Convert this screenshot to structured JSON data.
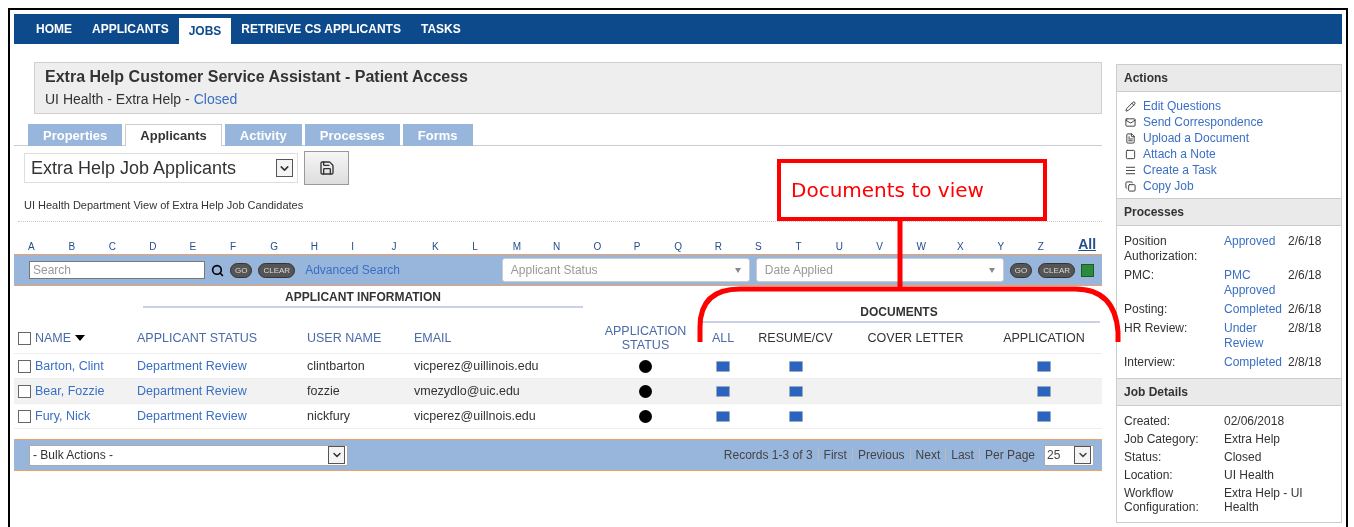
{
  "nav": [
    {
      "label": "HOME",
      "selected": false
    },
    {
      "label": "APPLICANTS",
      "selected": false
    },
    {
      "label": "JOBS",
      "selected": true
    },
    {
      "label": "RETRIEVE CS APPLICANTS",
      "selected": false
    },
    {
      "label": "TASKS",
      "selected": false
    }
  ],
  "job": {
    "title": "Extra Help Customer Service Assistant - Patient Access",
    "subtitle": "UI Health - Extra Help -",
    "status": "Closed"
  },
  "tabs": [
    {
      "label": "Properties",
      "selected": false
    },
    {
      "label": "Applicants",
      "selected": true
    },
    {
      "label": "Activity",
      "selected": false
    },
    {
      "label": "Processes",
      "selected": false
    },
    {
      "label": "Forms",
      "selected": false
    }
  ],
  "view": {
    "value": "Extra Help Job Applicants",
    "description": "UI Health Department View of Extra Help Job Candidates"
  },
  "alphabet": [
    "A",
    "B",
    "C",
    "D",
    "E",
    "F",
    "G",
    "H",
    "I",
    "J",
    "K",
    "L",
    "M",
    "N",
    "O",
    "P",
    "Q",
    "R",
    "S",
    "T",
    "U",
    "V",
    "W",
    "X",
    "Y",
    "Z"
  ],
  "alphabet_all": "All",
  "filters": {
    "search": {
      "placeholder": "Search"
    },
    "go": "GO",
    "clear": "CLEAR",
    "advanced_search": "Advanced Search",
    "applicant_status": {
      "placeholder": "Applicant Status"
    },
    "date_applied": {
      "placeholder": "Date Applied"
    },
    "go_2": "GO",
    "clear_2": "CLEAR"
  },
  "table": {
    "groups": [
      "APPLICANT INFORMATION",
      "DOCUMENTS"
    ],
    "select_all": {
      "checked": false
    },
    "columns": [
      {
        "label": "NAME",
        "sortable": true
      },
      {
        "label": "APPLICANT STATUS",
        "sortable": true
      },
      {
        "label": "USER NAME",
        "sortable": true
      },
      {
        "label": "EMAIL",
        "sortable": true
      },
      {
        "label": "APPLICATION STATUS",
        "sortable": true
      },
      {
        "label": "ALL",
        "sortable": true
      },
      {
        "label": "RESUME/CV",
        "sortable": false
      },
      {
        "label": "COVER LETTER",
        "sortable": false
      },
      {
        "label": "APPLICATION",
        "sortable": false
      }
    ],
    "rows": [
      {
        "checked": false,
        "name": "Barton, Clint",
        "status": "Department Review",
        "username": "clintbarton",
        "email": "vicperez@uillinois.edu",
        "documents": [
          true,
          true,
          false,
          true
        ]
      },
      {
        "checked": false,
        "name": "Bear, Fozzie",
        "status": "Department Review",
        "username": "fozzie",
        "email": "vmezydlo@uic.edu",
        "documents": [
          true,
          true,
          false,
          true
        ]
      },
      {
        "checked": false,
        "name": "Fury, Nick",
        "status": "Department Review",
        "username": "nickfury",
        "email": "vicperez@uillnois.edu",
        "documents": [
          true,
          true,
          false,
          true
        ]
      }
    ]
  },
  "footer": {
    "bulk_actions": "- Bulk Actions -",
    "records": "Records 1-3 of 3",
    "pager": [
      "First",
      "Previous",
      "Next",
      "Last"
    ],
    "per_page_label": "Per Page",
    "per_page": "25"
  },
  "sidebar": {
    "actions": {
      "title": "Actions",
      "items": [
        "Edit Questions",
        "Send Correspondence",
        "Upload a Document",
        "Attach a Note",
        "Create a Task",
        "Copy Job"
      ]
    },
    "processes": {
      "title": "Processes",
      "rows": [
        {
          "label": "Position Authorization:",
          "value": "Approved",
          "date": "2/6/18"
        },
        {
          "label": "PMC:",
          "value": "PMC Approved",
          "date": "2/6/18"
        },
        {
          "label": "Posting:",
          "value": "Completed",
          "date": "2/6/18"
        },
        {
          "label": "HR Review:",
          "value": "Under Review",
          "date": "2/8/18"
        },
        {
          "label": "Interview:",
          "value": "Completed",
          "date": "2/8/18"
        }
      ]
    },
    "job_details": {
      "title": "Job Details",
      "rows": [
        {
          "label": "Created:",
          "value": "02/06/2018"
        },
        {
          "label": "Job Category:",
          "value": "Extra Help"
        },
        {
          "label": "Status:",
          "value": "Closed"
        },
        {
          "label": "Location:",
          "value": "UI Health"
        },
        {
          "label": "Workflow Configuration:",
          "value": "Extra Help - UI Health"
        }
      ]
    }
  },
  "annotation": {
    "text": "Documents to view"
  }
}
